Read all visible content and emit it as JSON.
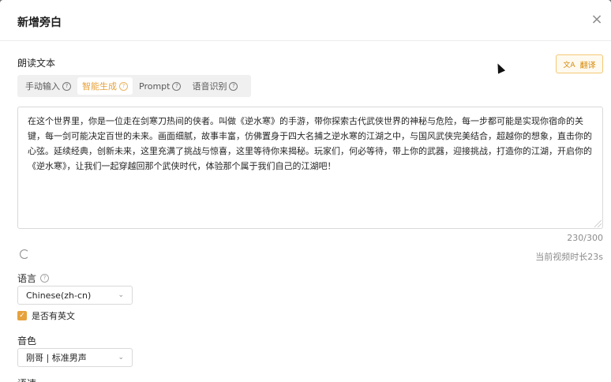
{
  "dialog": {
    "title": "新增旁白",
    "close_icon": "×"
  },
  "text_section": {
    "label": "朗读文本",
    "translate_label": "翻译",
    "translate_icon": "文A",
    "tabs": [
      {
        "label": "手动输入",
        "active": false
      },
      {
        "label": "智能生成",
        "active": true
      },
      {
        "label": "Prompt",
        "active": false
      },
      {
        "label": "语音识别",
        "active": false
      }
    ],
    "content": "在这个世界里，你是一位走在剑寒刀热间的侠者。叫做《逆水寒》的手游，带你探索古代武侠世界的神秘与危险，每一步都可能是实现你宿命的关键，每一剑可能决定百世的未来。画面细腻，故事丰富，仿佛置身于四大名捕之逆水寒的江湖之中，与国风武侠完美结合，超越你的想象，直击你的心弦。延续经典，创新未来，这里充满了挑战与惊喜，这里等待你来揭秘。玩家们，何必等待，带上你的武器，迎接挑战，打造你的江湖，开启你的《逆水寒》，让我们一起穿越回那个武侠时代，体验那个属于我们自己的江湖吧！",
    "counter": "230/300",
    "duration": "当前视频时长23s"
  },
  "language": {
    "label": "语言",
    "selected": "Chinese(zh-cn)",
    "has_english_label": "是否有英文",
    "has_english_checked": true
  },
  "voice": {
    "label": "音色",
    "selected": "刚哥 | 标准男声"
  },
  "speed": {
    "label": "语速"
  },
  "colors": {
    "accent": "#e6a23c",
    "translate_border": "#f4c874"
  }
}
